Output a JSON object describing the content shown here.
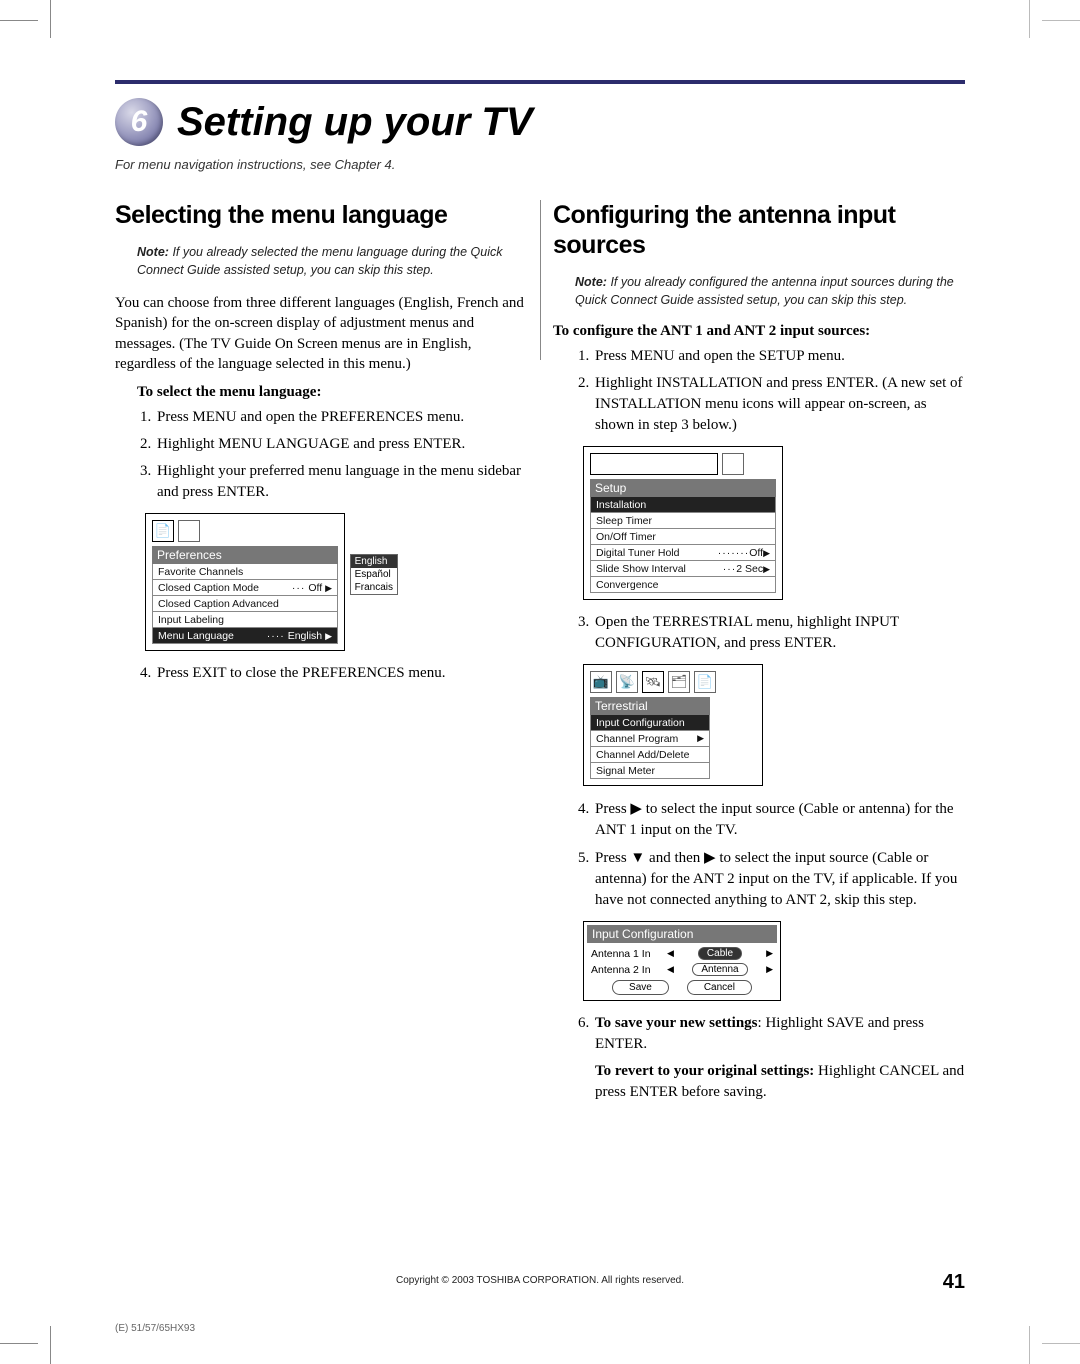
{
  "chapter": {
    "number": "6",
    "title": "Setting up your TV",
    "subtitle": "For menu navigation instructions, see Chapter 4."
  },
  "left": {
    "heading": "Selecting the menu language",
    "note_label": "Note:",
    "note": "If you already selected the menu language during the Quick Connect Guide assisted setup, you can skip this step.",
    "intro": "You can choose from three different languages (English, French and Spanish) for the on-screen display of adjustment menus and messages. (The TV Guide On Screen menus are in English, regardless of the language selected in this menu.)",
    "procedure_title": "To select the menu language:",
    "steps": [
      "Press MENU and open the PREFERENCES menu.",
      "Highlight MENU LANGUAGE and press ENTER.",
      "Highlight your preferred menu language in the menu sidebar and press ENTER."
    ],
    "step4": "Press EXIT to close the PREFERENCES menu.",
    "osd": {
      "title": "Preferences",
      "rows": [
        {
          "label": "Favorite Channels",
          "value": ""
        },
        {
          "label": "Closed Caption Mode",
          "value": "Off",
          "arrow": true
        },
        {
          "label": "Closed Caption Advanced",
          "value": ""
        },
        {
          "label": "Input Labeling",
          "value": ""
        },
        {
          "label": "Menu Language",
          "value": "English",
          "arrow": true,
          "selected": true
        }
      ],
      "side_options": [
        "English",
        "Español",
        "Francais"
      ],
      "side_selected": "English"
    }
  },
  "right": {
    "heading": "Configuring the antenna input sources",
    "note_label": "Note:",
    "note": "If you already configured the antenna input sources during the Quick Connect Guide assisted setup, you can skip this step.",
    "procedure_title": "To configure the ANT 1 and ANT 2 input sources:",
    "steps12": [
      "Press MENU and open the SETUP menu.",
      "Highlight INSTALLATION and press ENTER. (A new set of INSTALLATION menu icons will appear on-screen, as shown in step 3 below.)"
    ],
    "osd_setup": {
      "title": "Setup",
      "rows": [
        {
          "label": "Installation",
          "selected": true
        },
        {
          "label": "Sleep Timer"
        },
        {
          "label": "On/Off Timer"
        },
        {
          "label": "Digital Tuner Hold",
          "value": "Off",
          "arrow": true
        },
        {
          "label": "Slide Show Interval",
          "value": "2 Sec",
          "arrow": true
        },
        {
          "label": "Convergence"
        }
      ]
    },
    "step3": "Open the TERRESTRIAL menu, highlight INPUT CONFIGURATION, and press ENTER.",
    "osd_terr": {
      "title": "Terrestrial",
      "rows": [
        {
          "label": "Input Configuration",
          "selected": true
        },
        {
          "label": "Channel Program",
          "arrow": true
        },
        {
          "label": "Channel Add/Delete"
        },
        {
          "label": "Signal Meter"
        }
      ]
    },
    "step4_pre": "Press ",
    "step4_post": " to select the input source (Cable or antenna) for the ANT 1 input on the TV.",
    "step5_pre1": "Press ",
    "step5_mid": " and then ",
    "step5_post": " to select the input source (Cable or antenna) for the ANT 2 input on the TV, if applicable. If you have not connected anything to ANT 2, skip this step.",
    "osd_input": {
      "title": "Input Configuration",
      "row1_label": "Antenna 1 In",
      "row1_value": "Cable",
      "row2_label": "Antenna 2 In",
      "row2_value": "Antenna",
      "save": "Save",
      "cancel": "Cancel"
    },
    "step6_a_bold": "To save your new settings",
    "step6_a_rest": ": Highlight SAVE and press ENTER.",
    "step6_b_bold": "To revert to your original settings:",
    "step6_b_rest": " Highlight CANCEL and press ENTER before saving."
  },
  "footer": {
    "copyright": "Copyright © 2003 TOSHIBA CORPORATION. All rights reserved.",
    "page": "41",
    "code": "(E) 51/57/65HX93"
  },
  "glyphs": {
    "right": "▶",
    "down": "▼",
    "left": "◀"
  }
}
